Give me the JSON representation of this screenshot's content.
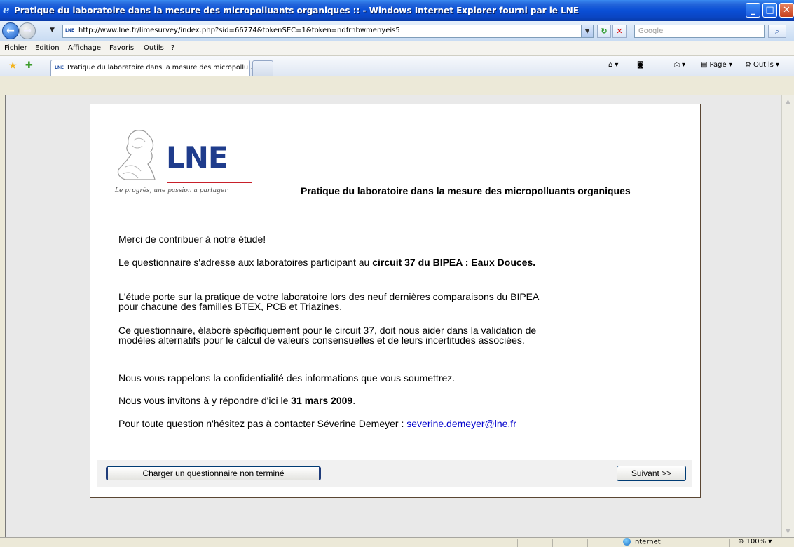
{
  "window": {
    "title": "Pratique du laboratoire dans la mesure des micropolluants organiques :: - Windows Internet Explorer fourni par le LNE"
  },
  "address_bar": {
    "url": "http://www.lne.fr/limesurvey/index.php?sid=66774&tokenSEC=1&token=ndfrnbwmenyeis5",
    "favicon_text": "LNE",
    "search_placeholder": "Google"
  },
  "menu": {
    "items": [
      "Fichier",
      "Edition",
      "Affichage",
      "Favoris",
      "Outils",
      "?"
    ]
  },
  "tabs": {
    "active_label": "Pratique du laboratoire dans la mesure des micropollu...",
    "favicon_text": "LNE"
  },
  "command_bar": {
    "page_label": "Page",
    "tools_label": "Outils"
  },
  "logo": {
    "brand": "LNE",
    "tagline": "Le progrès, une passion à partager"
  },
  "survey": {
    "title": "Pratique du laboratoire dans la mesure des micropolluants organiques",
    "p1": "Merci de contribuer à notre étude!",
    "p2_pre": "Le questionnaire s'adresse aux laboratoires participant au ",
    "p2_bold": "circuit 37 du BIPEA : Eaux Douces.",
    "p3": "L'étude porte sur  la pratique de votre laboratoire lors des neuf dernières comparaisons du BIPEA pour chacune des  familles BTEX, PCB et Triazines.",
    "p4": "Ce questionnaire, élaboré spécifiquement pour le circuit 37, doit nous aider dans la validation de modèles alternatifs pour le calcul de valeurs consensuelles et de leurs incertitudes associées.",
    "p5": "Nous vous rappelons la confidentialité des informations que vous soumettrez.",
    "p6_pre": "Nous vous invitons à y répondre d'ici le ",
    "p6_bold": "31 mars 2009",
    "p6_post": ".",
    "p7_pre": "Pour toute question n'hésitez pas à contacter Séverine Demeyer : ",
    "p7_email": "severine.demeyer@lne.fr"
  },
  "buttons": {
    "load": "Charger un questionnaire non terminé",
    "next": "Suivant >>"
  },
  "status_bar": {
    "zone": "Internet",
    "zoom": "100%"
  }
}
